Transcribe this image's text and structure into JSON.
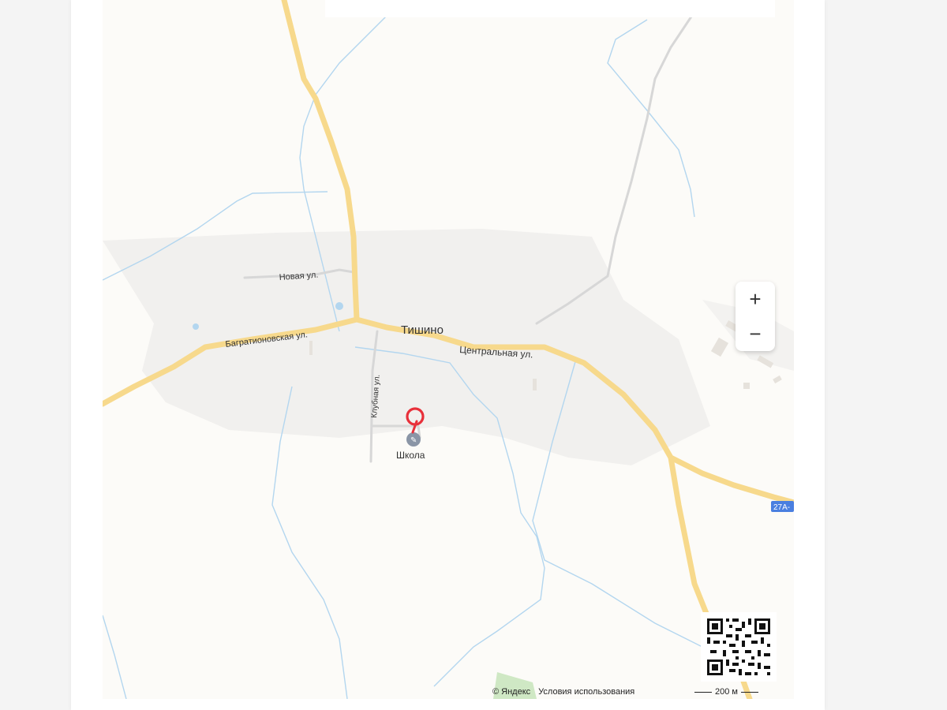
{
  "map": {
    "place_label": "Тишино",
    "streets": {
      "novaya": "Новая ул.",
      "bagrationovskaya": "Багратионовская ул.",
      "tsentralnaya": "Центральная ул.",
      "klubnaya": "Клубная ул."
    },
    "poi": {
      "label": "Школа",
      "icon": "school-icon"
    },
    "road_shield": "27А-",
    "marker_icon": "location-pin-icon",
    "colors": {
      "background": "#fcfbf8",
      "settlement": "#f1f0ee",
      "major_road": "#f7d98c",
      "minor_road": "#d7d7d7",
      "water": "#b3d6ef",
      "marker": "#e8303a",
      "shield": "#4a7fe0"
    }
  },
  "controls": {
    "zoom_in": "+",
    "zoom_out": "−"
  },
  "footer": {
    "copyright": "© Яндекс",
    "terms": "Условия использования",
    "scale": "200 м"
  }
}
